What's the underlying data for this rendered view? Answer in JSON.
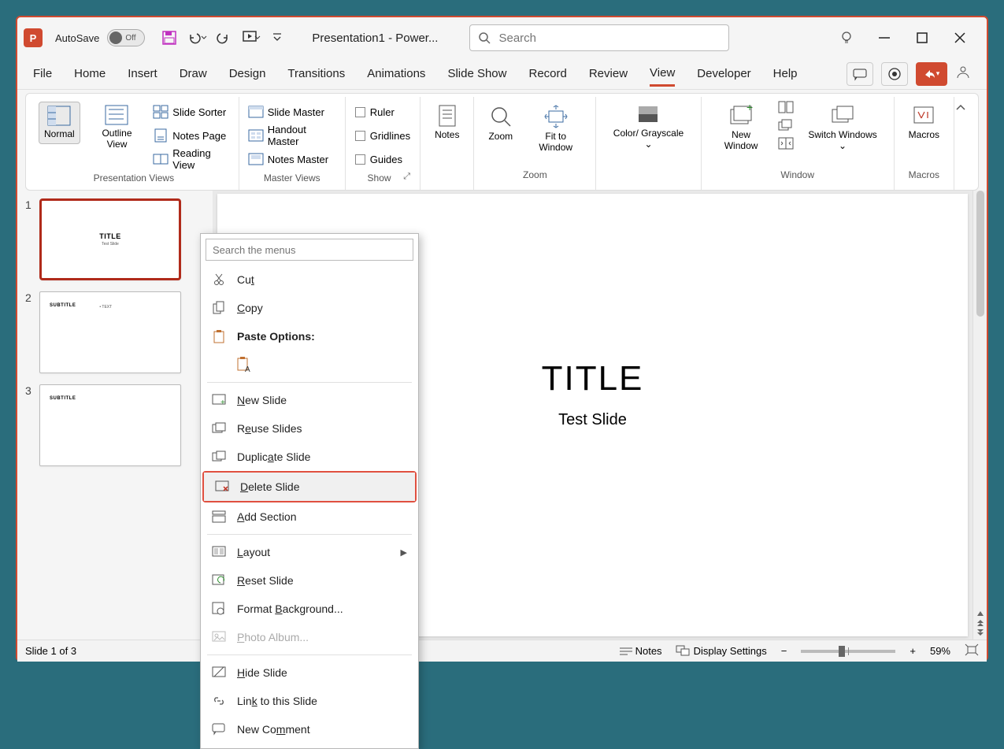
{
  "titlebar": {
    "autosave_label": "AutoSave",
    "autosave_state": "Off",
    "doc_title": "Presentation1 - Power...",
    "search_placeholder": "Search"
  },
  "tabs": {
    "items": [
      "File",
      "Home",
      "Insert",
      "Draw",
      "Design",
      "Transitions",
      "Animations",
      "Slide Show",
      "Record",
      "Review",
      "View",
      "Developer",
      "Help"
    ],
    "active": "View"
  },
  "ribbon": {
    "presentation_views": {
      "label": "Presentation Views",
      "normal": "Normal",
      "outline": "Outline View",
      "slide_sorter": "Slide Sorter",
      "notes_page": "Notes Page",
      "reading_view": "Reading View"
    },
    "master_views": {
      "label": "Master Views",
      "slide_master": "Slide Master",
      "handout_master": "Handout Master",
      "notes_master": "Notes Master"
    },
    "show": {
      "label": "Show",
      "ruler": "Ruler",
      "gridlines": "Gridlines",
      "guides": "Guides"
    },
    "notes": "Notes",
    "zoom_group": {
      "label": "Zoom",
      "zoom": "Zoom",
      "fit": "Fit to Window"
    },
    "color": {
      "label": "Color/ Grayscale"
    },
    "window": {
      "label": "Window",
      "new": "New Window",
      "switch": "Switch Windows"
    },
    "macros": {
      "label": "Macros",
      "btn": "Macros"
    }
  },
  "slides": [
    {
      "num": "1",
      "title": "TITLE",
      "subtitle": "Test Slide",
      "selected": true,
      "layout": "center"
    },
    {
      "num": "2",
      "title": "SUBTITLE",
      "body": "• TEXT",
      "layout": "left"
    },
    {
      "num": "3",
      "title": "SUBTITLE",
      "layout": "left"
    }
  ],
  "canvas": {
    "title": "TITLE",
    "subtitle": "Test Slide"
  },
  "context_menu": {
    "search_placeholder": "Search the menus",
    "items": {
      "cut": "Cut",
      "copy": "Copy",
      "paste_header": "Paste Options:",
      "new_slide": "New Slide",
      "reuse": "Reuse Slides",
      "duplicate": "Duplicate Slide",
      "delete": "Delete Slide",
      "add_section": "Add Section",
      "layout": "Layout",
      "reset": "Reset Slide",
      "format_bg": "Format Background...",
      "photo_album": "Photo Album...",
      "hide": "Hide Slide",
      "link": "Link to this Slide",
      "new_comment": "New Comment"
    }
  },
  "statusbar": {
    "slide_pos": "Slide 1 of 3",
    "notes": "Notes",
    "display": "Display Settings",
    "zoom": "59%"
  }
}
